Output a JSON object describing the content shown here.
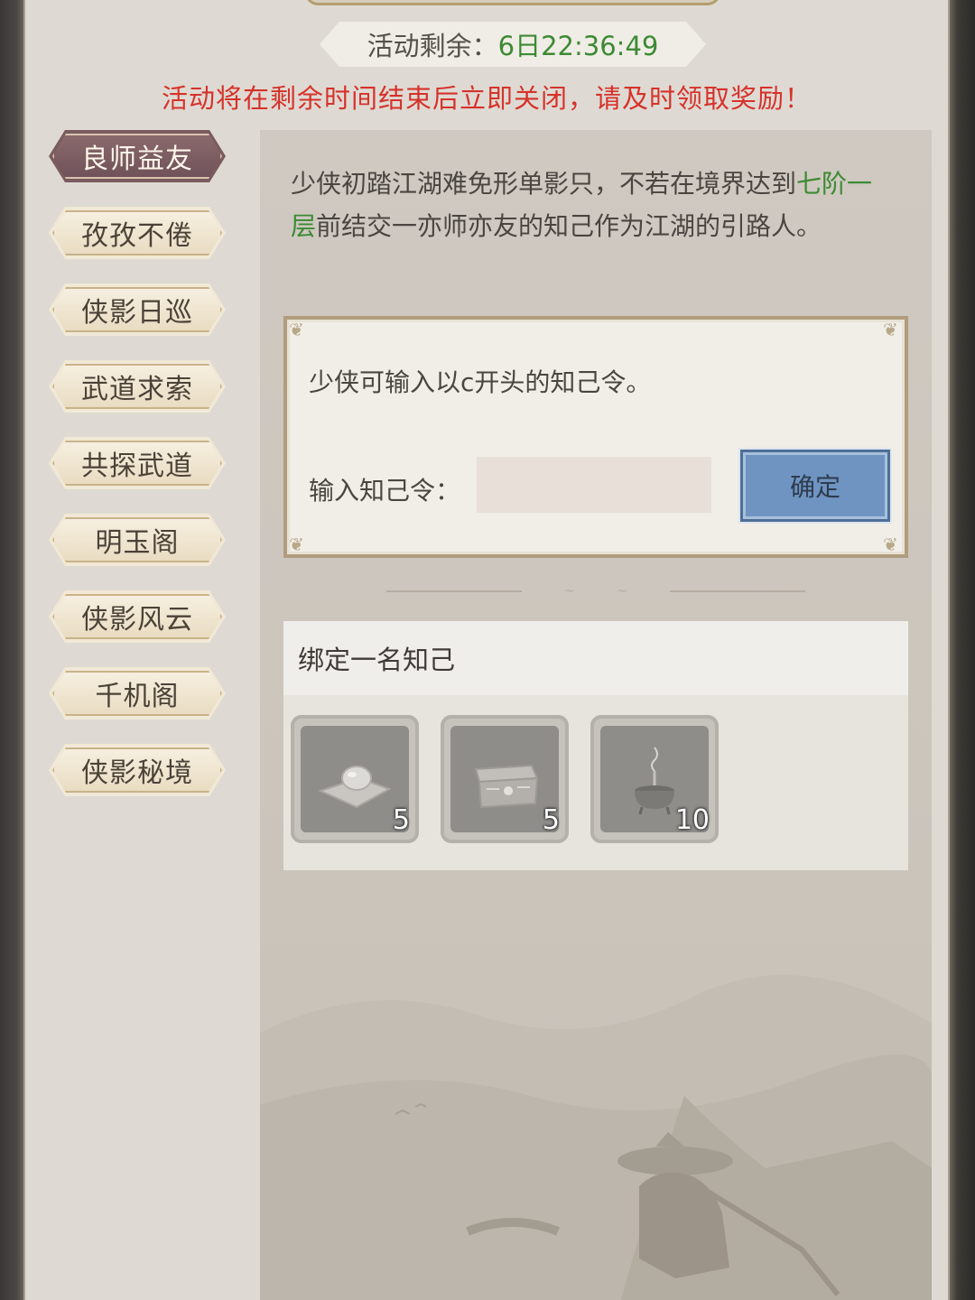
{
  "timer": {
    "label": "活动剩余：",
    "value": "6日22:36:49"
  },
  "warning": "活动将在剩余时间结束后立即关闭，请及时领取奖励！",
  "nav": {
    "items": [
      {
        "label": "良师益友",
        "active": true
      },
      {
        "label": "孜孜不倦",
        "active": false
      },
      {
        "label": "侠影日巡",
        "active": false
      },
      {
        "label": "武道求索",
        "active": false
      },
      {
        "label": "共探武道",
        "active": false
      },
      {
        "label": "明玉阁",
        "active": false
      },
      {
        "label": "侠影风云",
        "active": false
      },
      {
        "label": "千机阁",
        "active": false
      },
      {
        "label": "侠影秘境",
        "active": false
      }
    ]
  },
  "description": {
    "part1": "少侠初踏江湖难免形单影只，不若在境界达到",
    "highlight": "七阶一层",
    "part2": "前结交一亦师亦友的知己作为江湖的引路人。"
  },
  "code_box": {
    "tip": "少侠可输入以c开头的知己令。",
    "label": "输入知己令：",
    "input_value": "",
    "input_placeholder": "",
    "confirm_label": "确定"
  },
  "rewards": {
    "title": "绑定一名知己",
    "items": [
      {
        "icon": "jade-orb-on-cloth-icon",
        "count": "5"
      },
      {
        "icon": "treasure-chest-icon",
        "count": "5"
      },
      {
        "icon": "incense-pot-icon",
        "count": "10"
      }
    ]
  },
  "colors": {
    "accent_green": "#3d8a34",
    "warning_red": "#d6322a",
    "active_tab": "#7a5b5e",
    "confirm_blue": "#6f94c2"
  }
}
